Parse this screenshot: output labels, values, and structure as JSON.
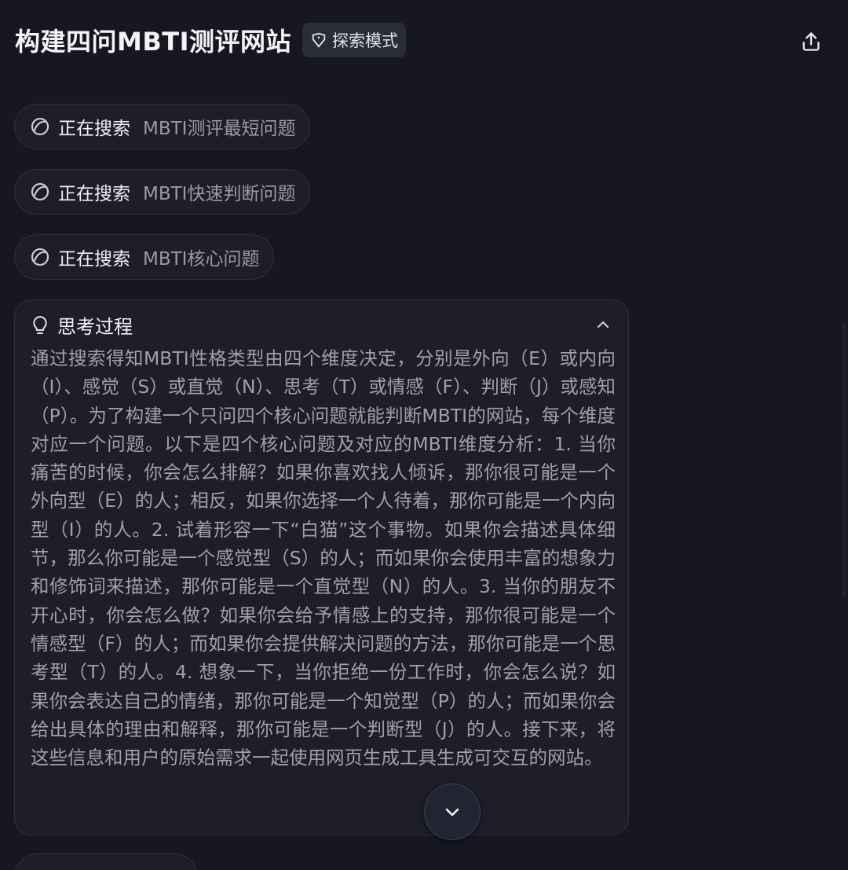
{
  "header": {
    "title": "构建四问MBTI测评网站",
    "mode_badge": "探索模式",
    "mode_icon": "tag-icon",
    "share_icon": "share-upload-icon"
  },
  "searches": [
    {
      "label": "正在搜索",
      "query": "MBTI测评最短问题"
    },
    {
      "label": "正在搜索",
      "query": "MBTI快速判断问题"
    },
    {
      "label": "正在搜索",
      "query": "MBTI核心问题"
    }
  ],
  "thinking": {
    "title": "思考过程",
    "icon": "lightbulb-icon",
    "text": "通过搜索得知MBTI性格类型由四个维度决定，分别是外向（E）或内向（I）、感觉（S）或直觉（N）、思考（T）或情感（F）、判断（J）或感知（P）。为了构建一个只问四个核心问题就能判断MBTI的网站，每个维度对应一个问题。以下是四个核心问题及对应的MBTI维度分析：1. 当你痛苦的时候，你会怎么排解？如果你喜欢找人倾诉，那你很可能是一个外向型（E）的人；相反，如果你选择一个人待着，那你可能是一个内向型（I）的人。2. 试着形容一下“白猫”这个事物。如果你会描述具体细节，那么你可能是一个感觉型（S）的人；而如果你会使用丰富的想象力和修饰词来描述，那你可能是一个直觉型（N）的人。3. 当你的朋友不开心时，你会怎么做？如果你会给予情感上的支持，那你很可能是一个情感型（F）的人；而如果你会提供解决问题的方法，那你可能是一个思考型（T）的人。4. 想象一下，当你拒绝一份工作时，你会怎么说？如果你会表达自己的情绪，那你可能是一个知觉型（P）的人；而如果你会给出具体的理由和解释，那你可能是一个判断型（J）的人。接下来，将这些信息和用户的原始需求一起使用网页生成工具生成可交互的网站。"
  },
  "colors": {
    "background": "#161722",
    "card": "#1d1e2a",
    "border": "#2f313d",
    "text_primary": "#f1f1f5",
    "text_secondary": "#9fa0ab"
  }
}
